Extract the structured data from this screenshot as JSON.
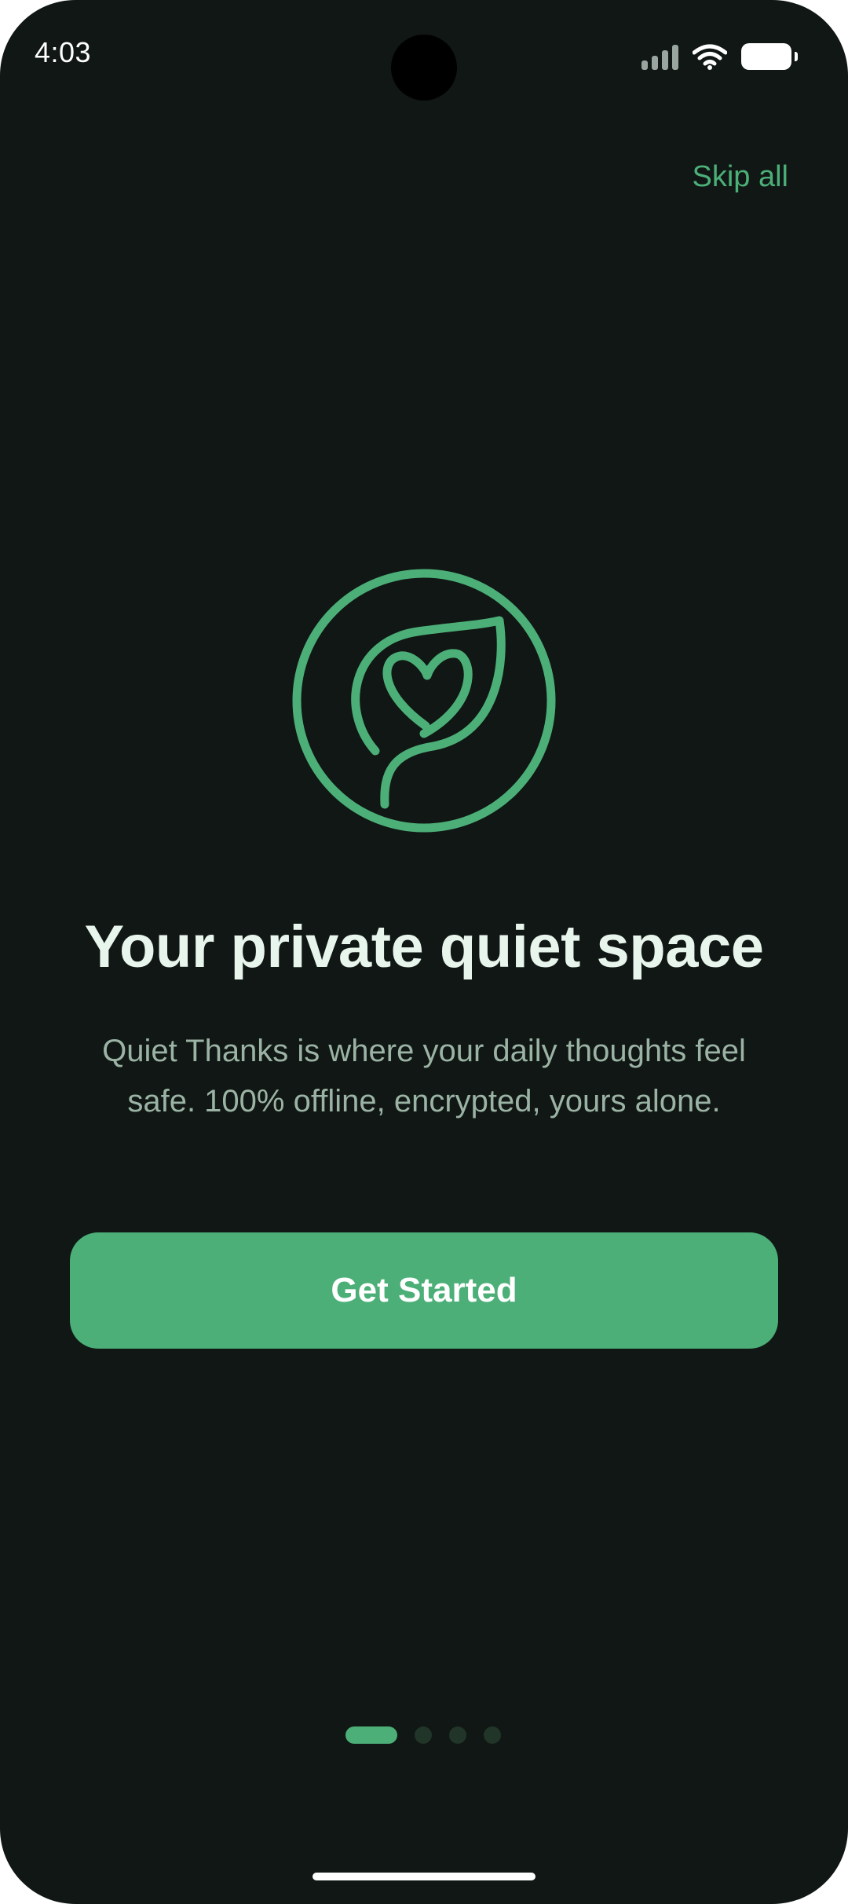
{
  "status_bar": {
    "time": "4:03"
  },
  "header": {
    "skip_label": "Skip all"
  },
  "onboarding": {
    "title": "Your private quiet space",
    "description": "Quiet Thanks is where your daily thoughts feel safe. 100% offline, encrypted, yours alone.",
    "cta_label": "Get Started",
    "logo_icon": "leaf-heart-icon"
  },
  "pagination": {
    "total_pages": 4,
    "current_page": 1
  },
  "colors": {
    "background": "#101714",
    "accent": "#4caf78",
    "title": "#e8f5ec",
    "body_text": "#9bb3a5",
    "inactive_dot": "#213529"
  }
}
